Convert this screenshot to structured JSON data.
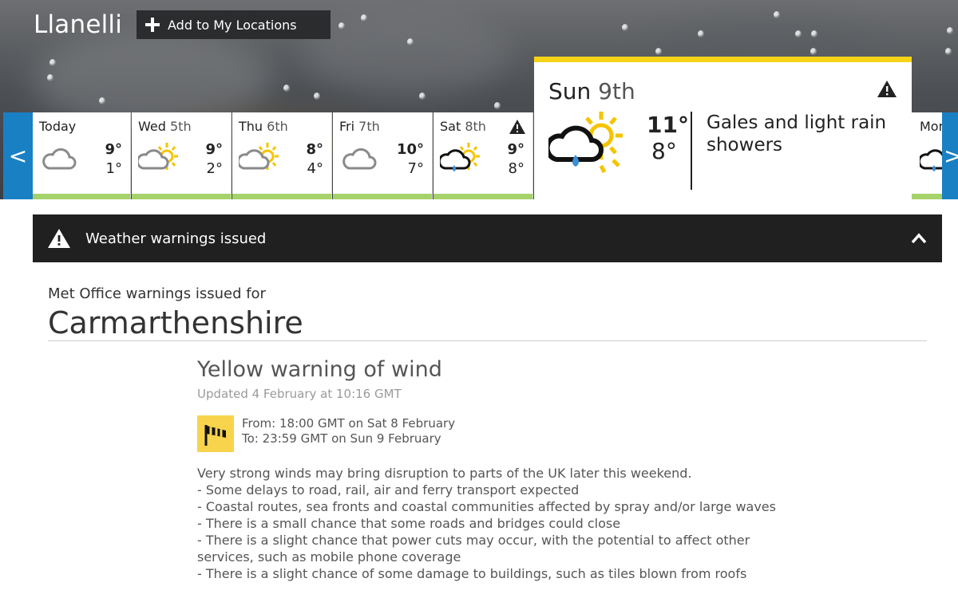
{
  "header": {
    "city": "Llanelli",
    "add_location_label": "Add to My Locations"
  },
  "nav": {
    "prev_arrow": "<",
    "next_arrow": ">"
  },
  "days": [
    {
      "day": "Today",
      "num": "",
      "high": "9°",
      "low": "1°",
      "icon": "cloud-icon",
      "warning": false
    },
    {
      "day": "Wed",
      "num": "5th",
      "high": "9°",
      "low": "2°",
      "icon": "sun-cloud-icon",
      "warning": false
    },
    {
      "day": "Thu",
      "num": "6th",
      "high": "8°",
      "low": "4°",
      "icon": "sun-cloud-icon",
      "warning": false
    },
    {
      "day": "Fri",
      "num": "7th",
      "high": "10°",
      "low": "7°",
      "icon": "cloud-icon",
      "warning": false
    },
    {
      "day": "Sat",
      "num": "8th",
      "high": "9°",
      "low": "8°",
      "icon": "sun-cloud-rain-icon",
      "warning": true
    }
  ],
  "selected_day": {
    "day": "Sun",
    "num": "9th",
    "high": "11°",
    "low": "8°",
    "description": "Gales and light rain showers",
    "icon": "sun-cloud-rain-icon",
    "warning": true
  },
  "next_day_peek": {
    "label": "Mon"
  },
  "warnings_bar": {
    "text": "Weather warnings issued",
    "toggle": "collapse"
  },
  "warnings": {
    "issued_for_label": "Met Office warnings issued for",
    "county": "Carmarthenshire",
    "title": "Yellow warning of wind",
    "updated": "Updated 4 February at 10:16 GMT",
    "from": "From: 18:00 GMT on Sat 8 February",
    "to": "To: 23:59 GMT on Sun 9 February",
    "body": [
      "Very strong winds may bring disruption to parts of the UK later this weekend.",
      "- Some delays to road, rail, air and ferry transport expected",
      "- Coastal routes, sea fronts and coastal communities affected by spray and/or large waves",
      "- There is a small chance that some roads and bridges could close",
      "- There is a slight chance that power cuts may occur, with the potential to affect other services, such as mobile phone coverage",
      "- There is a slight chance of some damage to buildings, such as tiles blown from roofs"
    ]
  },
  "colors": {
    "accent_blue": "#1a80c4",
    "warning_yellow": "#f7d417",
    "rating_green": "#a5d26a",
    "bar_dark": "#202020"
  }
}
